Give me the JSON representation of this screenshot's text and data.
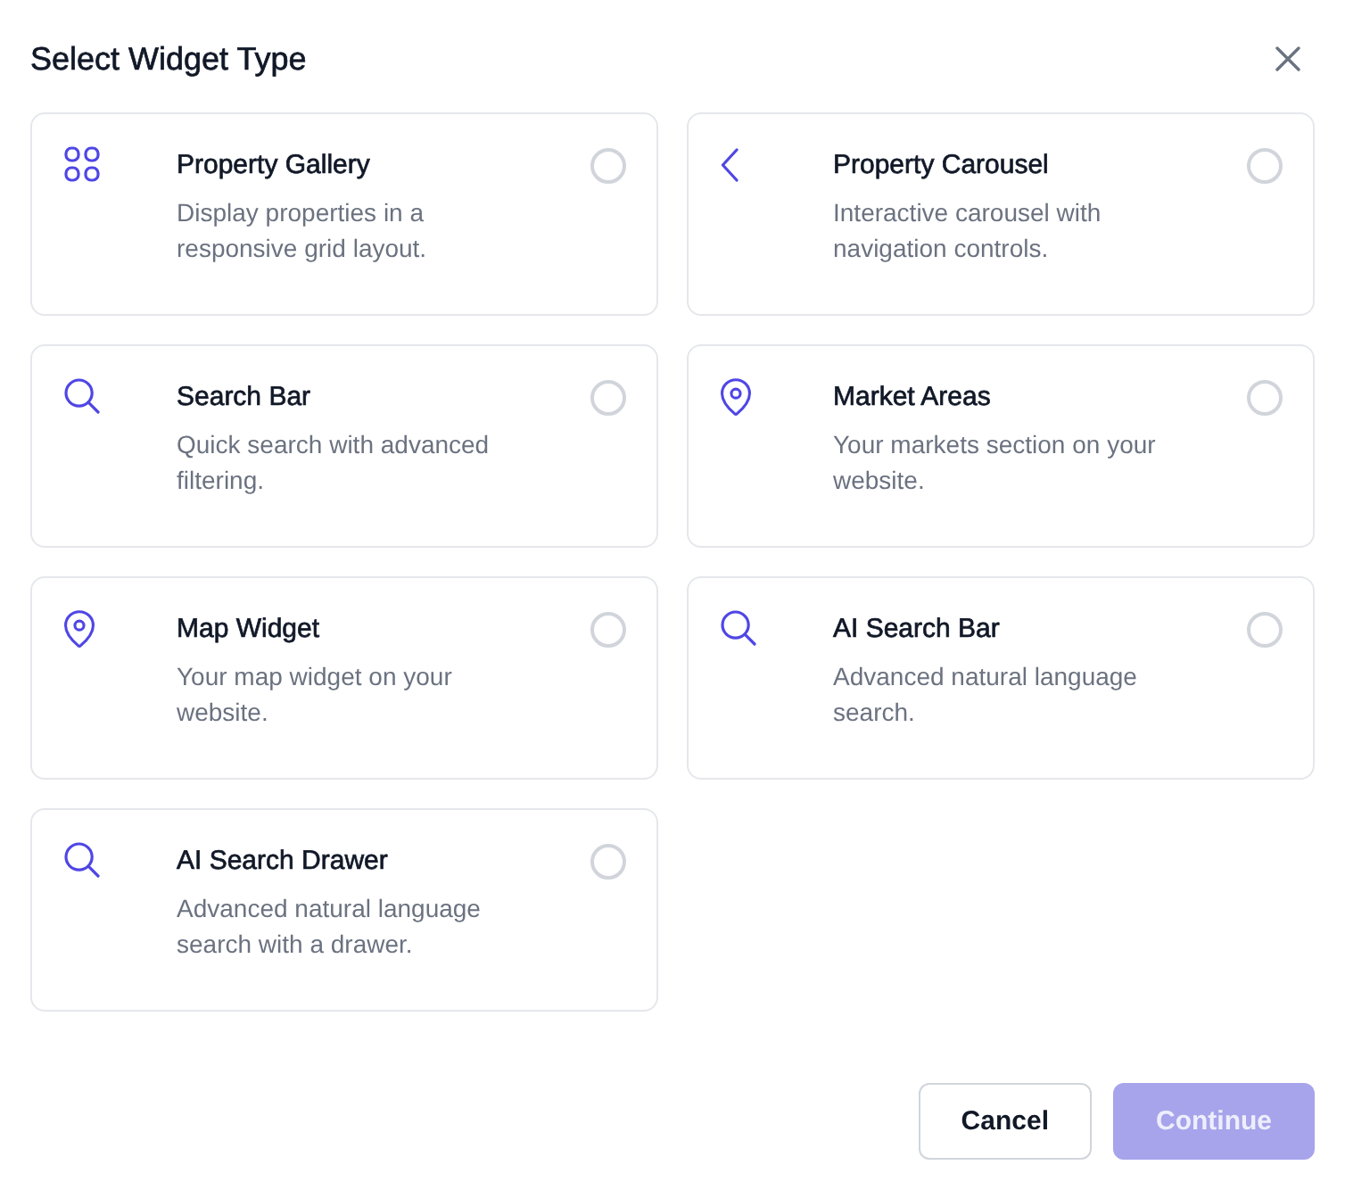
{
  "dialog": {
    "title": "Select Widget Type"
  },
  "widgets": [
    {
      "kind": "grid",
      "title": "Property Gallery",
      "description": "Display properties in a responsive grid layout.",
      "selected": false
    },
    {
      "kind": "chevron",
      "title": "Property Carousel",
      "description": "Interactive carousel with navigation controls.",
      "selected": false
    },
    {
      "kind": "search",
      "title": "Search Bar",
      "description": "Quick search with advanced filtering.",
      "selected": false
    },
    {
      "kind": "pin",
      "title": "Market Areas",
      "description": "Your markets section on your website.",
      "selected": false
    },
    {
      "kind": "pin",
      "title": "Map Widget",
      "description": "Your map widget on your website.",
      "selected": false
    },
    {
      "kind": "search",
      "title": "AI Search Bar",
      "description": "Advanced natural language search.",
      "selected": false
    },
    {
      "kind": "search",
      "title": "AI Search Drawer",
      "description": "Advanced natural language search with a drawer.",
      "selected": false
    }
  ],
  "buttons": [
    {
      "kind": "secondary",
      "label": "Cancel",
      "disabled": false
    },
    {
      "kind": "primary",
      "label": "Continue",
      "disabled": true
    }
  ]
}
